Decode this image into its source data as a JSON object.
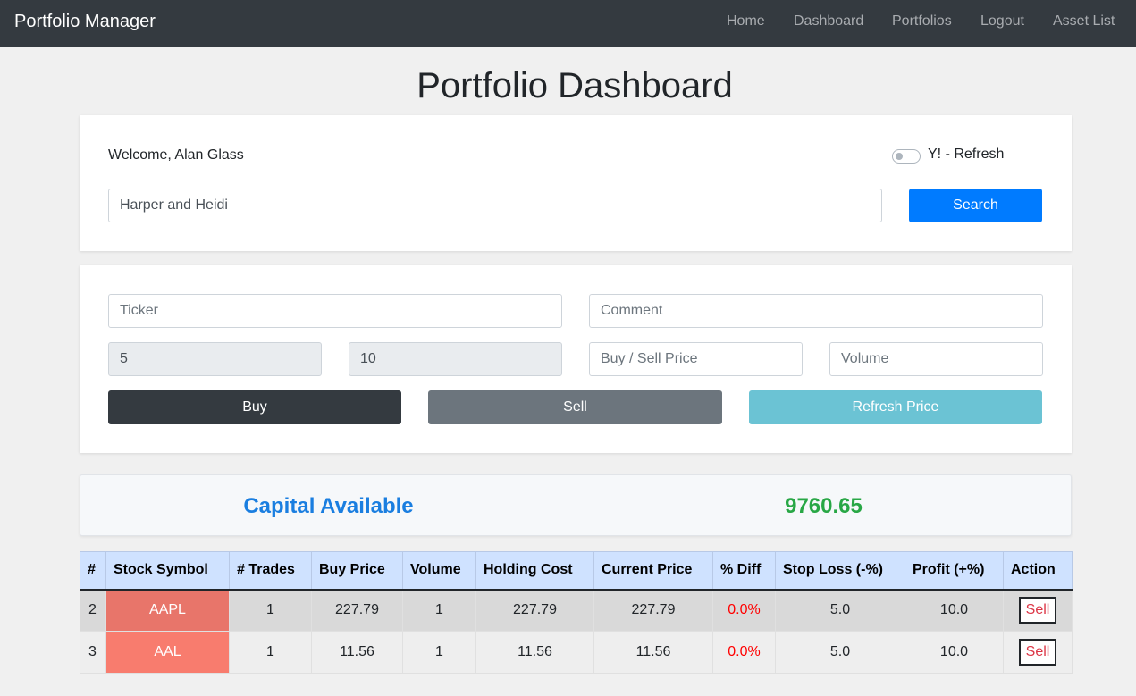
{
  "navbar": {
    "brand": "Portfolio Manager",
    "links": [
      "Home",
      "Dashboard",
      "Portfolios",
      "Logout",
      "Asset List"
    ]
  },
  "page": {
    "title": "Portfolio Dashboard"
  },
  "user_panel": {
    "welcome": "Welcome, Alan Glass",
    "toggle_label": "Y! - Refresh",
    "toggle_on": false,
    "search_value": "Harper and Heidi",
    "search_button": "Search"
  },
  "trade_form": {
    "ticker_placeholder": "Ticker",
    "comment_placeholder": "Comment",
    "field_a_value": "5",
    "field_b_value": "10",
    "price_placeholder": "Buy / Sell Price",
    "volume_placeholder": "Volume",
    "buy_label": "Buy",
    "sell_label": "Sell",
    "refresh_label": "Refresh Price"
  },
  "capital": {
    "label": "Capital Available",
    "value": "9760.65"
  },
  "holdings": {
    "columns": [
      "#",
      "Stock Symbol",
      "# Trades",
      "Buy Price",
      "Volume",
      "Holding Cost",
      "Current Price",
      "% Diff",
      "Stop Loss (-%)",
      "Profit (+%)",
      "Action"
    ],
    "rows": [
      {
        "num": "2",
        "symbol": "AAPL",
        "trades": "1",
        "buy_price": "227.79",
        "volume": "1",
        "holding_cost": "227.79",
        "current_price": "227.79",
        "diff": "0.0%",
        "stop_loss": "5.0",
        "profit": "10.0",
        "action": "Sell"
      },
      {
        "num": "3",
        "symbol": "AAL",
        "trades": "1",
        "buy_price": "11.56",
        "volume": "1",
        "holding_cost": "11.56",
        "current_price": "11.56",
        "diff": "0.0%",
        "stop_loss": "5.0",
        "profit": "10.0",
        "action": "Sell"
      }
    ]
  },
  "colors": {
    "navbar_bg": "#343a40",
    "primary": "#007bff",
    "capital_label": "#1a7ee0",
    "capital_value": "#28a745",
    "diff_text": "#ff0000",
    "sell_text": "#dc3545"
  }
}
